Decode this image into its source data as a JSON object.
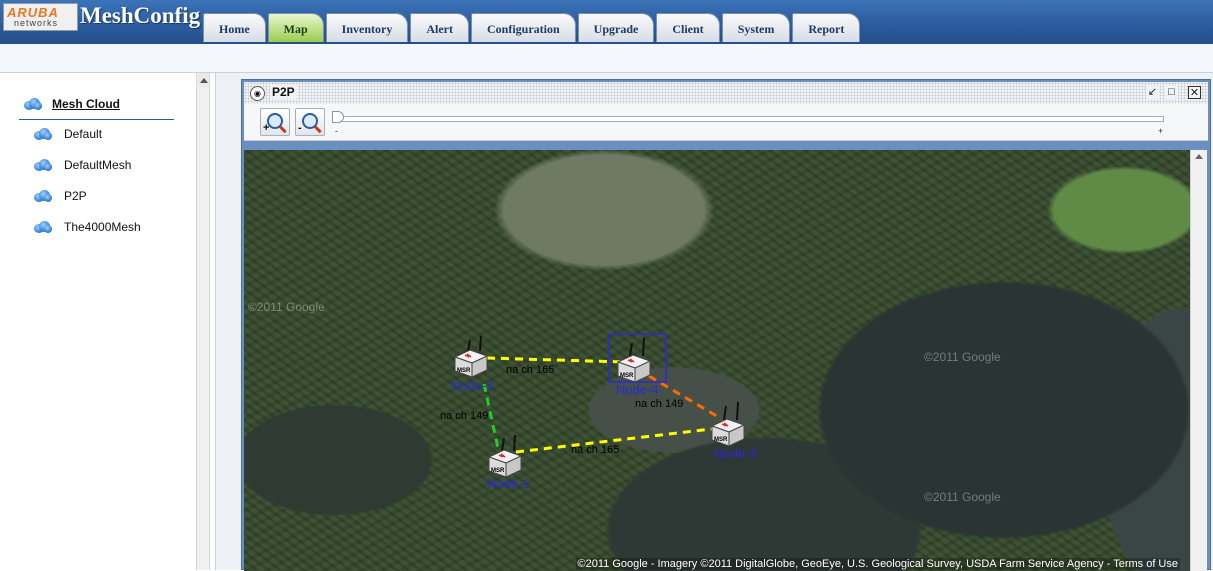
{
  "app": {
    "logo_brand": "ARUBA",
    "logo_sub": "networks",
    "title": "MeshConfig"
  },
  "tabs": [
    {
      "label": "Home",
      "active": false
    },
    {
      "label": "Map",
      "active": true
    },
    {
      "label": "Inventory",
      "active": false
    },
    {
      "label": "Alert",
      "active": false
    },
    {
      "label": "Configuration",
      "active": false
    },
    {
      "label": "Upgrade",
      "active": false
    },
    {
      "label": "Client",
      "active": false
    },
    {
      "label": "System",
      "active": false
    },
    {
      "label": "Report",
      "active": false
    }
  ],
  "tree": {
    "root_label": "Mesh Cloud",
    "items": [
      {
        "label": "Default"
      },
      {
        "label": "DefaultMesh"
      },
      {
        "label": "P2P"
      },
      {
        "label": "The4000Mesh"
      }
    ]
  },
  "window": {
    "title": "P2P",
    "icon": "globe-icon"
  },
  "zoom": {
    "in_sign": "+",
    "out_sign": "-",
    "slider_min": "-",
    "slider_max": "+",
    "level": 0
  },
  "map": {
    "nodes": [
      {
        "name": "Node-1",
        "label": "Node-1"
      },
      {
        "name": "Node-2",
        "label": "Node-2"
      },
      {
        "name": "Node-3",
        "label": "Node-3"
      },
      {
        "name": "Node-4",
        "label": "Node-4",
        "selected": true
      }
    ],
    "node_badge": "MSR",
    "links": [
      {
        "from": "Node-3",
        "to": "Node-4",
        "label": "na ch 165",
        "color": "#ffff00"
      },
      {
        "from": "Node-3",
        "to": "Node-1",
        "label": "na ch 149",
        "color": "#22cc22"
      },
      {
        "from": "Node-1",
        "to": "Node-2",
        "label": "na ch 165",
        "color": "#ffff00"
      },
      {
        "from": "Node-4",
        "to": "Node-2",
        "label": "na ch 149",
        "color": "#ff6a00"
      }
    ],
    "watermark": "©2011 Google",
    "copyright": "©2011 Google - Imagery ©2011 DigitalGlobe, GeoEye, U.S. Geological Survey, USDA Farm Service Agency - Terms of Use"
  },
  "colors": {
    "topbar": "#2a5b9d",
    "active_tab": "#9acd4d",
    "node_label": "#2a2ad6",
    "selection": "#2a2ad6"
  }
}
